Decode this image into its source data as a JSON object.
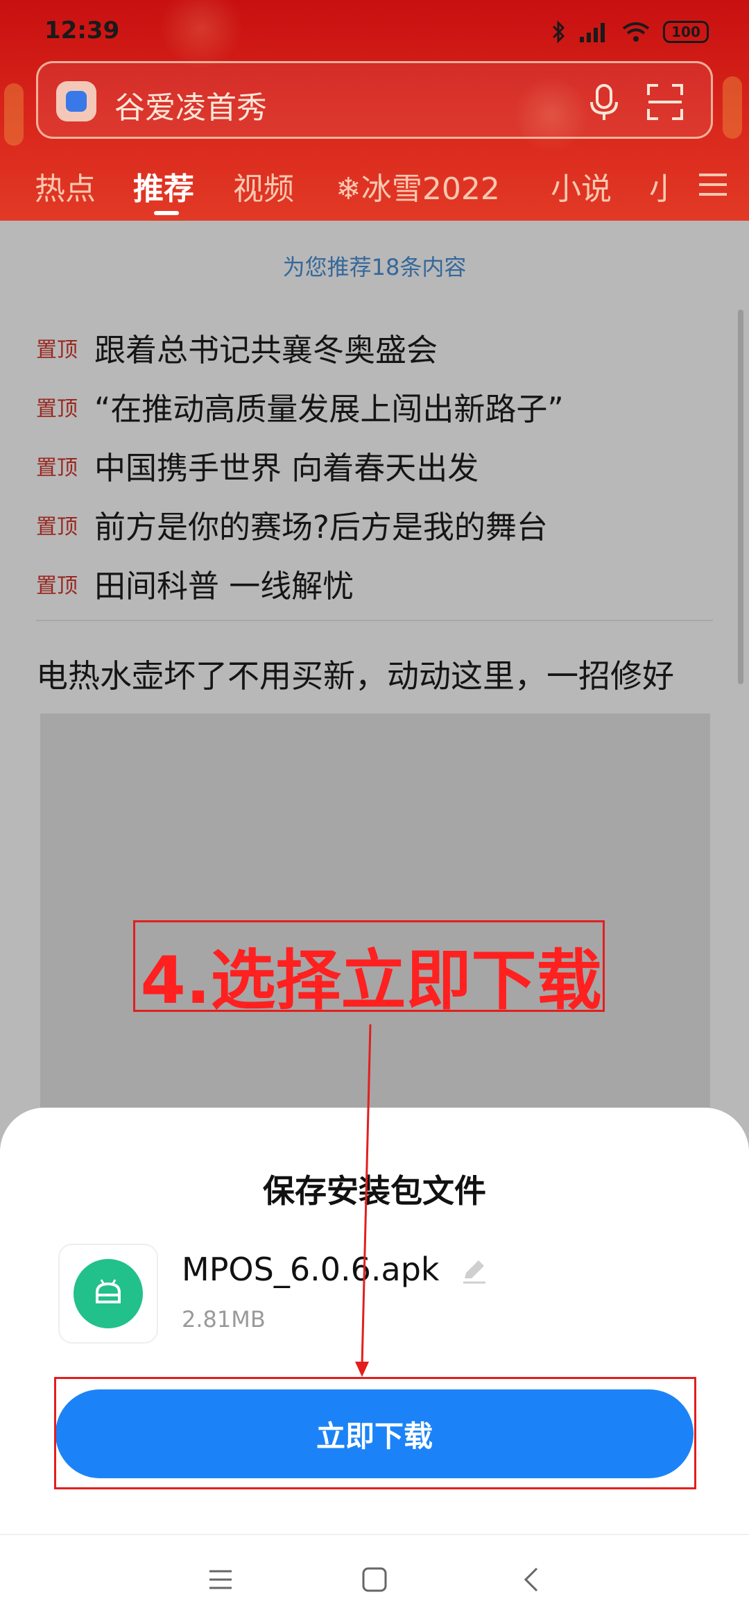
{
  "status_bar": {
    "time": "12:39",
    "battery": "100"
  },
  "search": {
    "placeholder_text": "谷爱凌首秀"
  },
  "tabs": [
    {
      "label": "热点"
    },
    {
      "label": "推荐"
    },
    {
      "label": "视频"
    },
    {
      "label": "冰雪2022"
    },
    {
      "label": "小说"
    },
    {
      "label": "小"
    }
  ],
  "feed": {
    "refresh_tip": "为您推荐18条内容",
    "pinned": [
      {
        "tag": "置顶",
        "title": "跟着总书记共襄冬奥盛会"
      },
      {
        "tag": "置顶",
        "title": "“在推动高质量发展上闯出新路子”"
      },
      {
        "tag": "置顶",
        "title": "中国携手世界 向着春天出发"
      },
      {
        "tag": "置顶",
        "title": "前方是你的赛场?后方是我的舞台"
      },
      {
        "tag": "置顶",
        "title": "田间科普 一线解忧"
      }
    ],
    "article_title": "电热水壶坏了不用买新，动动这里，一招修好"
  },
  "sheet": {
    "title": "保存安装包文件",
    "file_name": "MPOS_6.0.6.apk",
    "file_size": "2.81MB",
    "download_label": "立即下载"
  },
  "annotation": {
    "text": "4.选择立即下载"
  },
  "colors": {
    "header": "#d9261c",
    "accent": "#1b83f7",
    "annotation": "#e31e1e",
    "file_icon": "#22c08a"
  }
}
